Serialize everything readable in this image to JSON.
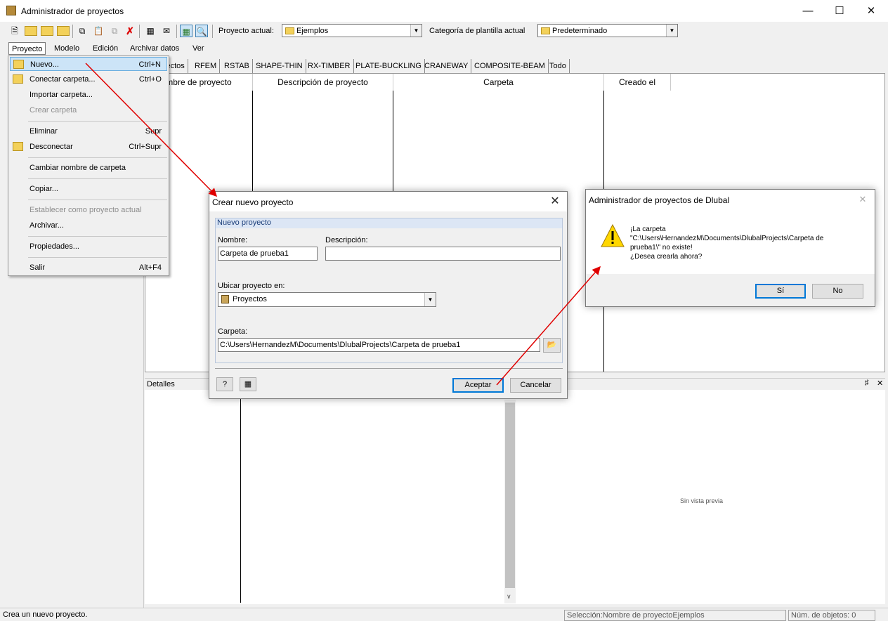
{
  "window": {
    "title": "Administrador de proyectos"
  },
  "toolbar": {
    "current_project_label": "Proyecto actual:",
    "current_project_value": "Ejemplos",
    "template_category_label": "Categoría de plantilla actual",
    "template_category_value": "Predeterminado"
  },
  "menubar": [
    "Proyecto",
    "Modelo",
    "Edición",
    "Archivar datos",
    "Ver"
  ],
  "tabs": [
    "yectos",
    "RFEM",
    "RSTAB",
    "SHAPE-THIN",
    "RX-TIMBER",
    "PLATE-BUCKLING",
    "CRANEWAY",
    "COMPOSITE-BEAM",
    "Todo"
  ],
  "grid": {
    "columns": [
      "mbre de proyecto",
      "Descripción de proyecto",
      "Carpeta",
      "Creado el"
    ]
  },
  "details": {
    "title": "Detalles",
    "no_preview": "Sin vista previa"
  },
  "dropdown": {
    "items": [
      {
        "label": "Nuevo...",
        "shortcut": "Ctrl+N"
      },
      {
        "label": "Conectar carpeta...",
        "shortcut": "Ctrl+O"
      },
      {
        "label": "Importar carpeta...",
        "shortcut": ""
      },
      {
        "label": "Crear carpeta",
        "shortcut": ""
      },
      {
        "label": "Eliminar",
        "shortcut": "Supr"
      },
      {
        "label": "Desconectar",
        "shortcut": "Ctrl+Supr"
      },
      {
        "label": "Cambiar nombre de carpeta",
        "shortcut": ""
      },
      {
        "label": "Copiar...",
        "shortcut": ""
      },
      {
        "label": "Establecer como proyecto actual",
        "shortcut": ""
      },
      {
        "label": "Archivar...",
        "shortcut": ""
      },
      {
        "label": "Propiedades...",
        "shortcut": ""
      },
      {
        "label": "Salir",
        "shortcut": "Alt+F4"
      }
    ]
  },
  "new_project_dialog": {
    "title": "Crear nuevo proyecto",
    "group_title": "Nuevo proyecto",
    "name_label": "Nombre:",
    "name_value": "Carpeta de prueba1",
    "description_label": "Descripción:",
    "description_value": "",
    "location_label": "Ubicar proyecto en:",
    "location_value": "Proyectos",
    "folder_label": "Carpeta:",
    "folder_value": "C:\\Users\\HernandezM\\Documents\\DlubalProjects\\Carpeta de prueba1",
    "ok_label": "Aceptar",
    "cancel_label": "Cancelar"
  },
  "message_dialog": {
    "title": "Administrador de proyectos de Dlubal",
    "lines": [
      "¡La carpeta",
      "\"C:\\Users\\HernandezM\\Documents\\DlubalProjects\\Carpeta de",
      "prueba1\\\" no existe!",
      "¿Desea crearla ahora?"
    ],
    "yes_label": "Sí",
    "no_label": "No"
  },
  "statusbar": {
    "message": "Crea un nuevo proyecto.",
    "selection": "Selección:Nombre de proyectoEjemplos",
    "count": "Núm. de objetos: 0"
  },
  "colors": {
    "highlight": "#cce4f7",
    "dialog_accent": "#0078d7",
    "arrow": "#e00000",
    "group_header": "#dce6f5"
  }
}
